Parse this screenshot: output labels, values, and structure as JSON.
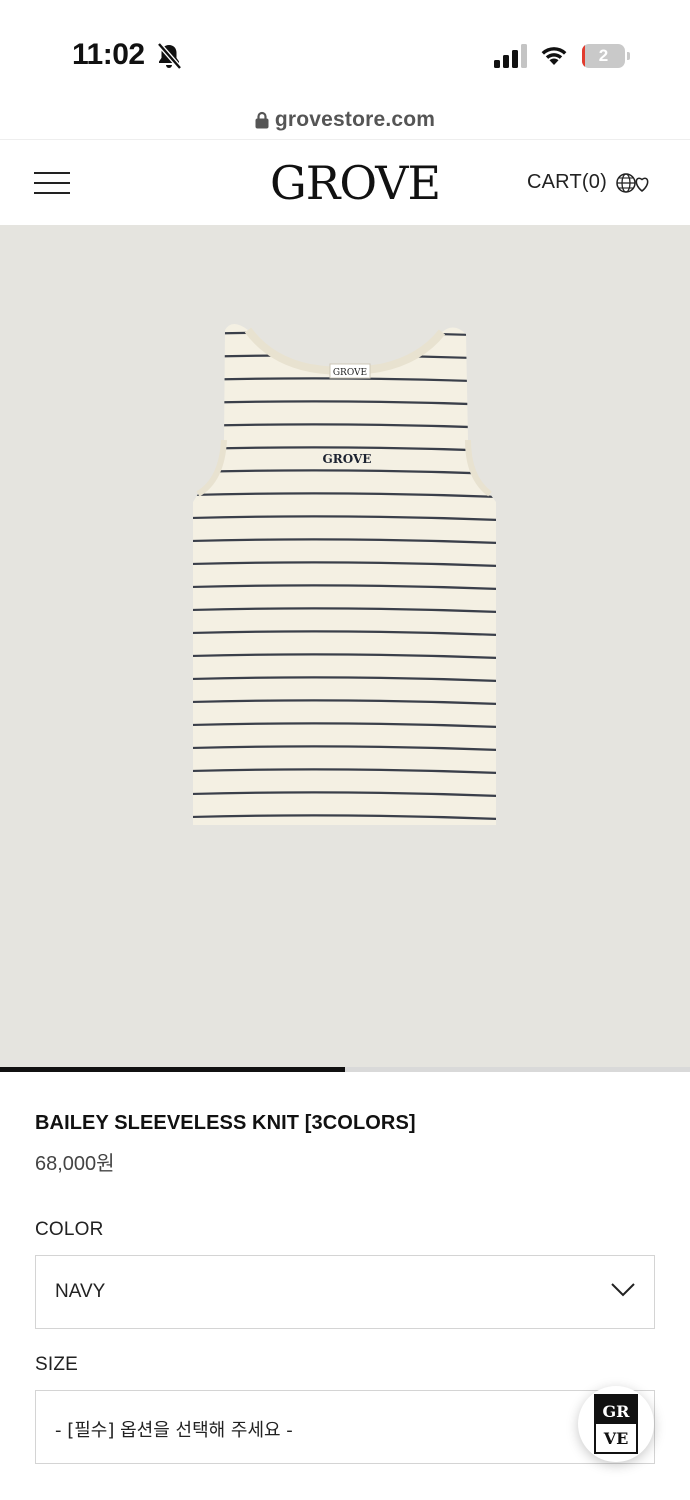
{
  "status_bar": {
    "time": "11:02",
    "battery_level": "2",
    "battery_fraction": 0.05,
    "icons": [
      "bell-slash-icon",
      "cellular-signal-icon",
      "wifi-icon",
      "battery-icon"
    ]
  },
  "browser": {
    "url": "grovestore.com"
  },
  "header": {
    "logo_text": "GROVE",
    "cart_label": "CART(0)",
    "icons": [
      "hamburger-menu-icon",
      "globe-heart-icon"
    ]
  },
  "gallery": {
    "product_image": "striped-sleeveless-knit-tank",
    "image_brand_mark": "GROVE",
    "progress_fraction": 0.5
  },
  "product": {
    "title": "BAILEY SLEEVELESS KNIT [3COLORS]",
    "price": "68,000원"
  },
  "options": {
    "color": {
      "label": "COLOR",
      "selected": "NAVY"
    },
    "size": {
      "label": "SIZE",
      "selected": "- [필수] 옵션을 선택해 주세요 -"
    }
  },
  "floating_button": {
    "icon": "brand-chat-icon",
    "mark_text": "GROVE"
  },
  "colors": {
    "image_background": "#e5e4df",
    "knit_body": "#f4f0e3",
    "stripe": "#3a3f4a",
    "progress_active": "#111111",
    "battery_low": "#e23b2e"
  }
}
